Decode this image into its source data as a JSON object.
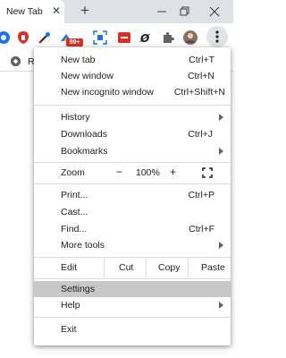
{
  "tab": {
    "title": "New Tab",
    "close_glyph": "✕"
  },
  "new_tab_glyph": "+",
  "window": {
    "minimize_icon": "minimize-icon",
    "maximize_icon": "restore-icon",
    "close_icon": "close-icon"
  },
  "toolbar": {
    "extensions": [
      "blue-circle-ext-icon",
      "red-shield-ext-icon",
      "eyedropper-ext-icon",
      "scribe-ext-icon",
      "qr-scan-ext-icon",
      "red-box-ext-icon",
      "link-ext-icon",
      "puzzle-icon",
      "avatar"
    ],
    "badge": "99+",
    "menu_icon": "kebab-menu-icon"
  },
  "bookmarks": {
    "visible_text": "R"
  },
  "colors": {
    "highlight": "#c8c8c8",
    "separator": "#dadce0",
    "tab_strip": "#dee1e6"
  },
  "menu": {
    "new_tab": {
      "label": "New tab",
      "shortcut": "Ctrl+T"
    },
    "new_window": {
      "label": "New window",
      "shortcut": "Ctrl+N"
    },
    "incognito": {
      "label": "New incognito window",
      "shortcut": "Ctrl+Shift+N"
    },
    "history": {
      "label": "History"
    },
    "downloads": {
      "label": "Downloads",
      "shortcut": "Ctrl+J"
    },
    "bookmarks": {
      "label": "Bookmarks"
    },
    "zoom": {
      "label": "Zoom",
      "minus": "−",
      "value": "100%",
      "plus": "+"
    },
    "print": {
      "label": "Print...",
      "shortcut": "Ctrl+P"
    },
    "cast": {
      "label": "Cast..."
    },
    "find": {
      "label": "Find...",
      "shortcut": "Ctrl+F"
    },
    "more_tools": {
      "label": "More tools"
    },
    "edit": {
      "label": "Edit",
      "cut": "Cut",
      "copy": "Copy",
      "paste": "Paste"
    },
    "settings": {
      "label": "Settings"
    },
    "help": {
      "label": "Help"
    },
    "exit": {
      "label": "Exit"
    }
  }
}
